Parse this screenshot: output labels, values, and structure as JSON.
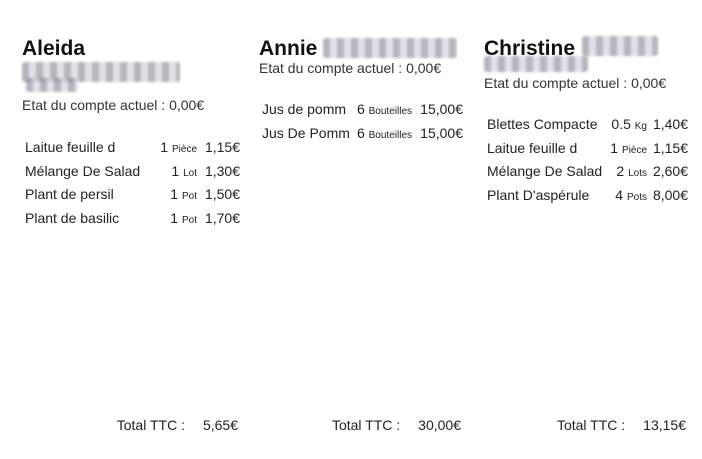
{
  "columns": [
    {
      "name": "Aleida",
      "account": "Etat du compte actuel : 0,00€",
      "items": [
        {
          "name": "Laitue feuille d",
          "qty": "1",
          "unit": "Pièce",
          "price": "1,15€"
        },
        {
          "name": "Mélange De Salad",
          "qty": "1",
          "unit": "Lot",
          "price": "1,30€"
        },
        {
          "name": "Plant de persil",
          "qty": "1",
          "unit": "Pot",
          "price": "1,50€"
        },
        {
          "name": "Plant de basilic",
          "qty": "1",
          "unit": "Pot",
          "price": "1,70€"
        }
      ],
      "total_label": "Total TTC :",
      "total_value": "5,65€"
    },
    {
      "name": "Annie",
      "account": "Etat du compte actuel : 0,00€",
      "items": [
        {
          "name": "Jus de pomm",
          "qty": "6",
          "unit": "Bouteilles",
          "price": "15,00€"
        },
        {
          "name": "Jus De Pomm",
          "qty": "6",
          "unit": "Bouteilles",
          "price": "15,00€"
        }
      ],
      "total_label": "Total TTC :",
      "total_value": "30,00€"
    },
    {
      "name": "Christine",
      "account": "Etat du compte actuel : 0,00€",
      "items": [
        {
          "name": "Blettes Compacte",
          "qty": "0.5",
          "unit": "Kg",
          "price": "1,40€"
        },
        {
          "name": "Laitue feuille d",
          "qty": "1",
          "unit": "Pièce",
          "price": "1,15€"
        },
        {
          "name": "Mélange De Salad",
          "qty": "2",
          "unit": "Lots",
          "price": "2,60€"
        },
        {
          "name": "Plant D'aspérule",
          "qty": "4",
          "unit": "Pots",
          "price": "8,00€"
        }
      ],
      "total_label": "Total TTC :",
      "total_value": "13,15€"
    }
  ]
}
